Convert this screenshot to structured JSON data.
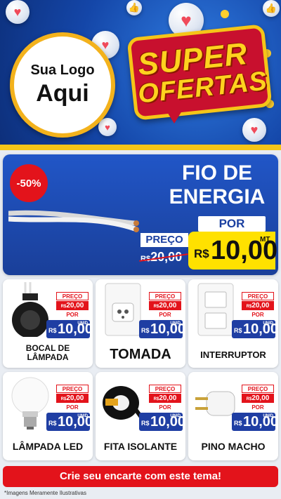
{
  "header": {
    "logo_line1": "Sua Logo",
    "logo_line2": "Aqui",
    "offer_line1": "SUPER",
    "offer_line2": "OFERTAS"
  },
  "hero": {
    "discount": "-50%",
    "title_line1": "FIO DE",
    "title_line2": "ENERGIA",
    "por_label": "POR",
    "preco_label": "PREÇO",
    "old_currency": "R$",
    "old_value": "20,00",
    "currency": "R$",
    "value": "10,00",
    "unit": "MT"
  },
  "products": [
    {
      "name": "BOCAL DE LÂMPADA",
      "icon": "bulb-socket-icon",
      "preco_label": "PREÇO",
      "old_currency": "R$",
      "old_value": "20,00",
      "por_label": "POR",
      "currency": "R$",
      "value": "10,00",
      "unit": "UNID"
    },
    {
      "name": "TOMADA",
      "icon": "outlet-icon",
      "preco_label": "PREÇO",
      "old_currency": "R$",
      "old_value": "20,00",
      "por_label": "POR",
      "currency": "R$",
      "value": "10,00",
      "unit": "UNID"
    },
    {
      "name": "INTERRUPTOR",
      "icon": "switch-icon",
      "preco_label": "PREÇO",
      "old_currency": "R$",
      "old_value": "20,00",
      "por_label": "POR",
      "currency": "R$",
      "value": "10,00",
      "unit": "UNID"
    },
    {
      "name": "LÂMPADA LED",
      "icon": "led-bulb-icon",
      "preco_label": "PREÇO",
      "old_currency": "R$",
      "old_value": "20,00",
      "por_label": "POR",
      "currency": "R$",
      "value": "10,00",
      "unit": "UNID"
    },
    {
      "name": "FITA ISOLANTE",
      "icon": "tape-icon",
      "preco_label": "PREÇO",
      "old_currency": "R$",
      "old_value": "20,00",
      "por_label": "POR",
      "currency": "R$",
      "value": "10,00",
      "unit": "UNID"
    },
    {
      "name": "PINO MACHO",
      "icon": "plug-icon",
      "preco_label": "PREÇO",
      "old_currency": "R$",
      "old_value": "20,00",
      "por_label": "POR",
      "currency": "R$",
      "value": "10,00",
      "unit": "UNID"
    }
  ],
  "cta": {
    "label": "Crie seu encarte com este tema!"
  },
  "disclaimer": "*Imagens Meramente Ilustrativas",
  "colors": {
    "brand_blue": "#1f3ea3",
    "accent_red": "#e3131b",
    "accent_yellow": "#ffe100"
  }
}
